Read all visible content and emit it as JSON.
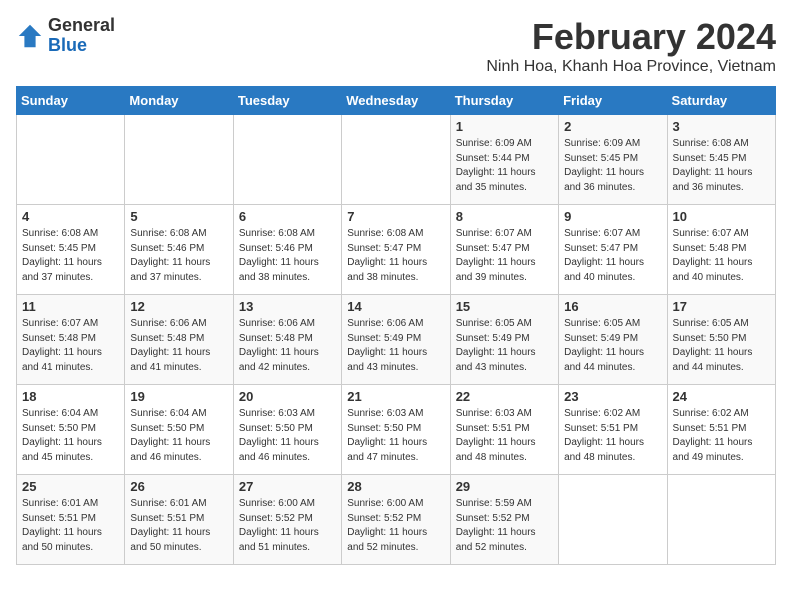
{
  "header": {
    "logo_general": "General",
    "logo_blue": "Blue",
    "month_title": "February 2024",
    "location": "Ninh Hoa, Khanh Hoa Province, Vietnam"
  },
  "days_of_week": [
    "Sunday",
    "Monday",
    "Tuesday",
    "Wednesday",
    "Thursday",
    "Friday",
    "Saturday"
  ],
  "weeks": [
    [
      {
        "day": "",
        "info": ""
      },
      {
        "day": "",
        "info": ""
      },
      {
        "day": "",
        "info": ""
      },
      {
        "day": "",
        "info": ""
      },
      {
        "day": "1",
        "info": "Sunrise: 6:09 AM\nSunset: 5:44 PM\nDaylight: 11 hours\nand 35 minutes."
      },
      {
        "day": "2",
        "info": "Sunrise: 6:09 AM\nSunset: 5:45 PM\nDaylight: 11 hours\nand 36 minutes."
      },
      {
        "day": "3",
        "info": "Sunrise: 6:08 AM\nSunset: 5:45 PM\nDaylight: 11 hours\nand 36 minutes."
      }
    ],
    [
      {
        "day": "4",
        "info": "Sunrise: 6:08 AM\nSunset: 5:45 PM\nDaylight: 11 hours\nand 37 minutes."
      },
      {
        "day": "5",
        "info": "Sunrise: 6:08 AM\nSunset: 5:46 PM\nDaylight: 11 hours\nand 37 minutes."
      },
      {
        "day": "6",
        "info": "Sunrise: 6:08 AM\nSunset: 5:46 PM\nDaylight: 11 hours\nand 38 minutes."
      },
      {
        "day": "7",
        "info": "Sunrise: 6:08 AM\nSunset: 5:47 PM\nDaylight: 11 hours\nand 38 minutes."
      },
      {
        "day": "8",
        "info": "Sunrise: 6:07 AM\nSunset: 5:47 PM\nDaylight: 11 hours\nand 39 minutes."
      },
      {
        "day": "9",
        "info": "Sunrise: 6:07 AM\nSunset: 5:47 PM\nDaylight: 11 hours\nand 40 minutes."
      },
      {
        "day": "10",
        "info": "Sunrise: 6:07 AM\nSunset: 5:48 PM\nDaylight: 11 hours\nand 40 minutes."
      }
    ],
    [
      {
        "day": "11",
        "info": "Sunrise: 6:07 AM\nSunset: 5:48 PM\nDaylight: 11 hours\nand 41 minutes."
      },
      {
        "day": "12",
        "info": "Sunrise: 6:06 AM\nSunset: 5:48 PM\nDaylight: 11 hours\nand 41 minutes."
      },
      {
        "day": "13",
        "info": "Sunrise: 6:06 AM\nSunset: 5:48 PM\nDaylight: 11 hours\nand 42 minutes."
      },
      {
        "day": "14",
        "info": "Sunrise: 6:06 AM\nSunset: 5:49 PM\nDaylight: 11 hours\nand 43 minutes."
      },
      {
        "day": "15",
        "info": "Sunrise: 6:05 AM\nSunset: 5:49 PM\nDaylight: 11 hours\nand 43 minutes."
      },
      {
        "day": "16",
        "info": "Sunrise: 6:05 AM\nSunset: 5:49 PM\nDaylight: 11 hours\nand 44 minutes."
      },
      {
        "day": "17",
        "info": "Sunrise: 6:05 AM\nSunset: 5:50 PM\nDaylight: 11 hours\nand 44 minutes."
      }
    ],
    [
      {
        "day": "18",
        "info": "Sunrise: 6:04 AM\nSunset: 5:50 PM\nDaylight: 11 hours\nand 45 minutes."
      },
      {
        "day": "19",
        "info": "Sunrise: 6:04 AM\nSunset: 5:50 PM\nDaylight: 11 hours\nand 46 minutes."
      },
      {
        "day": "20",
        "info": "Sunrise: 6:03 AM\nSunset: 5:50 PM\nDaylight: 11 hours\nand 46 minutes."
      },
      {
        "day": "21",
        "info": "Sunrise: 6:03 AM\nSunset: 5:50 PM\nDaylight: 11 hours\nand 47 minutes."
      },
      {
        "day": "22",
        "info": "Sunrise: 6:03 AM\nSunset: 5:51 PM\nDaylight: 11 hours\nand 48 minutes."
      },
      {
        "day": "23",
        "info": "Sunrise: 6:02 AM\nSunset: 5:51 PM\nDaylight: 11 hours\nand 48 minutes."
      },
      {
        "day": "24",
        "info": "Sunrise: 6:02 AM\nSunset: 5:51 PM\nDaylight: 11 hours\nand 49 minutes."
      }
    ],
    [
      {
        "day": "25",
        "info": "Sunrise: 6:01 AM\nSunset: 5:51 PM\nDaylight: 11 hours\nand 50 minutes."
      },
      {
        "day": "26",
        "info": "Sunrise: 6:01 AM\nSunset: 5:51 PM\nDaylight: 11 hours\nand 50 minutes."
      },
      {
        "day": "27",
        "info": "Sunrise: 6:00 AM\nSunset: 5:52 PM\nDaylight: 11 hours\nand 51 minutes."
      },
      {
        "day": "28",
        "info": "Sunrise: 6:00 AM\nSunset: 5:52 PM\nDaylight: 11 hours\nand 52 minutes."
      },
      {
        "day": "29",
        "info": "Sunrise: 5:59 AM\nSunset: 5:52 PM\nDaylight: 11 hours\nand 52 minutes."
      },
      {
        "day": "",
        "info": ""
      },
      {
        "day": "",
        "info": ""
      }
    ]
  ]
}
